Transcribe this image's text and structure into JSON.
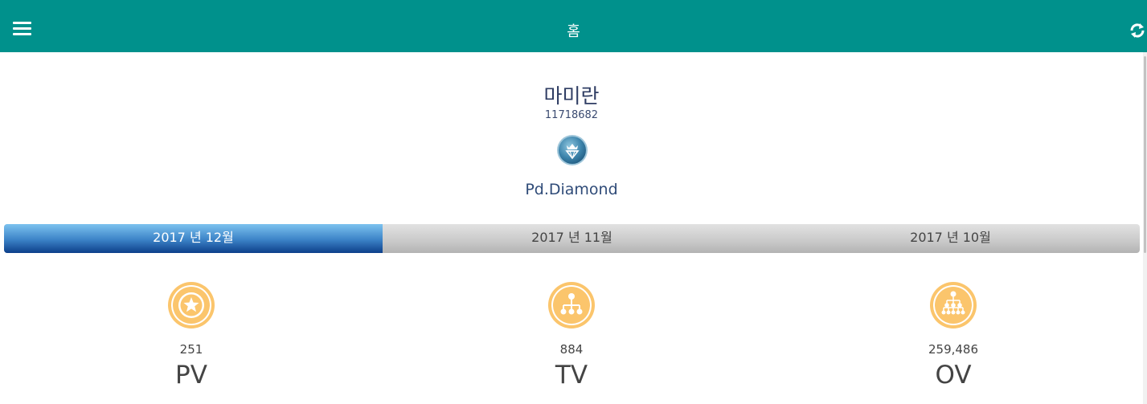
{
  "header": {
    "title": "홈",
    "menu_icon": "hamburger-menu-icon",
    "refresh_icon": "refresh-icon",
    "background_color": "#00918c"
  },
  "profile": {
    "name": "마미란",
    "member_id": "11718682",
    "rank_icon": "diamond-crown-badge-icon",
    "rank": "Pd.Diamond"
  },
  "tabs": [
    {
      "label": "2017 년 12월",
      "active": true
    },
    {
      "label": "2017 년 11월",
      "active": false
    },
    {
      "label": "2017 년 10월",
      "active": false
    }
  ],
  "stats": [
    {
      "icon": "star-circle-icon",
      "value": "251",
      "label": "PV"
    },
    {
      "icon": "team-tree-icon",
      "value": "884",
      "label": "TV"
    },
    {
      "icon": "organization-tree-icon",
      "value": "259,486",
      "label": "OV"
    }
  ],
  "colors": {
    "accent": "#00918c",
    "icon_orange": "#fbc56c",
    "tab_active": "#2f6fb8"
  }
}
